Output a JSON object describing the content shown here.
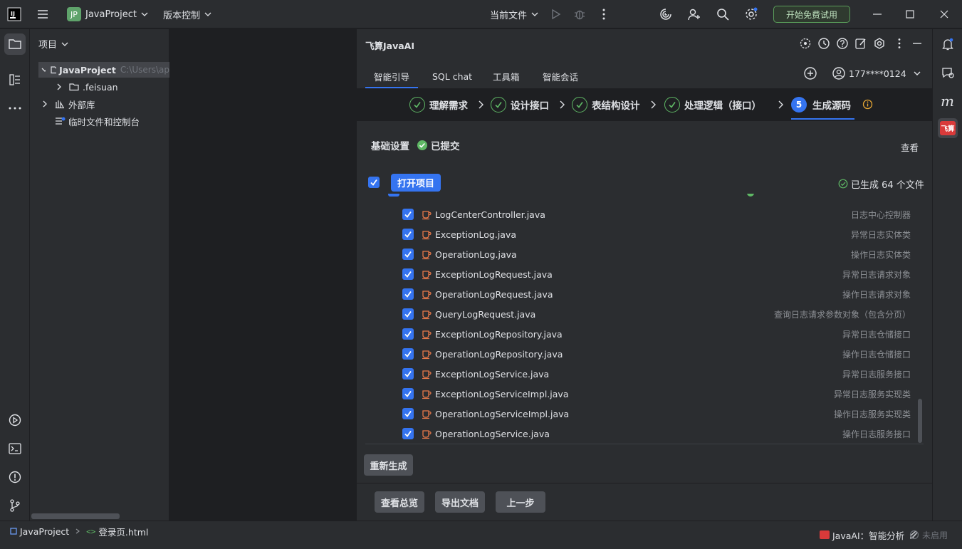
{
  "titlebar": {
    "project_badge": "JP",
    "project_name": "JavaProject",
    "vcs_label": "版本控制",
    "run_config": "当前文件",
    "trial_button": "开始免费试用"
  },
  "project_panel": {
    "title": "项目",
    "tree": [
      {
        "label": "JavaProject",
        "path": "C:\\Users\\ap",
        "level": 0,
        "expanded": true
      },
      {
        "label": ".feisuan",
        "level": 1
      },
      {
        "label": "外部库",
        "level": 0
      },
      {
        "label": "临时文件和控制台",
        "level": 0
      }
    ]
  },
  "ai_panel": {
    "title": "飞算JavaAI",
    "tabs": [
      {
        "label": "智能引导",
        "active": true
      },
      {
        "label": "SQL chat"
      },
      {
        "label": "工具箱"
      },
      {
        "label": "智能会话"
      }
    ],
    "user": "177****0124",
    "steps": [
      {
        "label": "理解需求",
        "done": true
      },
      {
        "label": "设计接口",
        "done": true
      },
      {
        "label": "表结构设计",
        "done": true
      },
      {
        "label": "处理逻辑（接口）",
        "done": true
      },
      {
        "label": "生成源码",
        "num": "5",
        "active": true
      }
    ],
    "basic": {
      "label": "基础设置",
      "status": "已提交",
      "view": "查看"
    },
    "open_project": "打开项目",
    "generated": "已生成 64 个文件",
    "files": [
      {
        "name": "LogCenterController.java",
        "desc": "日志中心控制器"
      },
      {
        "name": "ExceptionLog.java",
        "desc": "异常日志实体类"
      },
      {
        "name": "OperationLog.java",
        "desc": "操作日志实体类"
      },
      {
        "name": "ExceptionLogRequest.java",
        "desc": "异常日志请求对象"
      },
      {
        "name": "OperationLogRequest.java",
        "desc": "操作日志请求对象"
      },
      {
        "name": "QueryLogRequest.java",
        "desc": "查询日志请求参数对象（包含分页）"
      },
      {
        "name": "ExceptionLogRepository.java",
        "desc": "异常日志仓储接口"
      },
      {
        "name": "OperationLogRepository.java",
        "desc": "操作日志仓储接口"
      },
      {
        "name": "ExceptionLogService.java",
        "desc": "异常日志服务接口"
      },
      {
        "name": "ExceptionLogServiceImpl.java",
        "desc": "异常日志服务实现类"
      },
      {
        "name": "OperationLogServiceImpl.java",
        "desc": "操作日志服务实现类"
      },
      {
        "name": "OperationLogService.java",
        "desc": "操作日志服务接口"
      }
    ],
    "regenerate": "重新生成",
    "footer_buttons": [
      "查看总览",
      "导出文档",
      "上一步"
    ]
  },
  "right_strip": {
    "feisuan_badge": "飞算"
  },
  "statusbar": {
    "breadcrumb_project": "JavaProject",
    "breadcrumb_file": "登录页.html",
    "ai_label": "JavaAI：智能分析",
    "ai_status": "未启用"
  },
  "colors": {
    "accent": "#3574f0",
    "success": "#5fb865",
    "java_icon": "#e8794a"
  }
}
